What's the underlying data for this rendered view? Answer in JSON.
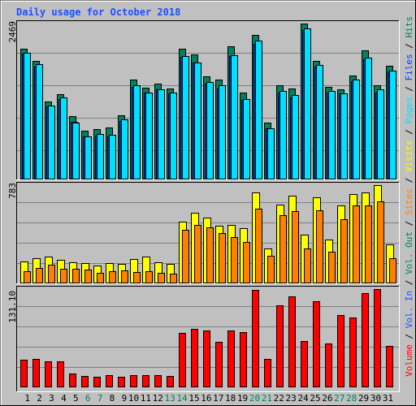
{
  "title": "Daily usage for October 2018",
  "colors": {
    "background": "#c0c0c0",
    "title": "#1a50ff",
    "gridline": "#808080",
    "weekday_label": "#000000",
    "weekend_label": "#00805c",
    "separator": "#000000"
  },
  "x_axis": {
    "weekend_days": [
      "6",
      "7",
      "13",
      "14",
      "20",
      "21",
      "27",
      "28"
    ]
  },
  "legend_separator": " / ",
  "legend": [
    {
      "label": "Volume",
      "color": "#ff0000"
    },
    {
      "label": "Vol. In",
      "color": "#1a50ff"
    },
    {
      "label": "Vol. Out",
      "color": "#00805c"
    },
    {
      "label": "Sites",
      "color": "#ff8000"
    },
    {
      "label": "Visits",
      "color": "#ffff00"
    },
    {
      "label": "Pages",
      "color": "#00e0ff"
    },
    {
      "label": "Files",
      "color": "#0040ff"
    },
    {
      "label": "Hits",
      "color": "#00805c"
    }
  ],
  "chart_data": [
    {
      "type": "bar",
      "panel": "hits-files-pages",
      "title": "Daily usage for October 2018",
      "xlabel": "",
      "ylabel": "",
      "ymax_label": "2469",
      "ylim": [
        0,
        2469
      ],
      "grid": true,
      "legend_placement": "right",
      "categories": [
        "1",
        "2",
        "3",
        "4",
        "5",
        "6",
        "7",
        "8",
        "9",
        "10",
        "11",
        "12",
        "13",
        "14",
        "15",
        "16",
        "17",
        "18",
        "19",
        "20",
        "21",
        "22",
        "23",
        "24",
        "25",
        "26",
        "27",
        "28",
        "29",
        "30",
        "31"
      ],
      "series": [
        {
          "name": "Hits",
          "color": "#00805c",
          "values": [
            2069,
            1875,
            1228,
            1345,
            996,
            763,
            789,
            815,
            1009,
            1577,
            1448,
            1513,
            1435,
            2069,
            1978,
            1629,
            1577,
            2108,
            1371,
            2289,
            892,
            1487,
            1435,
            2469,
            1875,
            1461,
            1422,
            1642,
            2043,
            1487,
            1797
          ]
        },
        {
          "name": "Files",
          "color": "#0040ff",
          "values": [
            1990,
            1788,
            1151,
            1267,
            905,
            672,
            685,
            672,
            918,
            1461,
            1371,
            1422,
            1358,
            1940,
            1849,
            1513,
            1435,
            1952,
            1254,
            2146,
            802,
            1371,
            1293,
            2366,
            1784,
            1371,
            1358,
            1552,
            1901,
            1371,
            1707
          ]
        },
        {
          "name": "Pages",
          "color": "#00e0ff",
          "values": [
            2004,
            1823,
            1164,
            1293,
            892,
            672,
            711,
            698,
            944,
            1487,
            1371,
            1422,
            1371,
            1952,
            1849,
            1539,
            1487,
            1965,
            1267,
            2198,
            802,
            1396,
            1332,
            2392,
            1810,
            1396,
            1358,
            1577,
            1927,
            1422,
            1720
          ]
        }
      ]
    },
    {
      "type": "bar",
      "panel": "visits-sites",
      "ymax_label": "783",
      "ylim": [
        0,
        783
      ],
      "grid": true,
      "categories": [
        "1",
        "2",
        "3",
        "4",
        "5",
        "6",
        "7",
        "8",
        "9",
        "10",
        "11",
        "12",
        "13",
        "14",
        "15",
        "16",
        "17",
        "18",
        "19",
        "20",
        "21",
        "22",
        "23",
        "24",
        "25",
        "26",
        "27",
        "28",
        "29",
        "30",
        "31"
      ],
      "series": [
        {
          "name": "Visits",
          "color": "#ffff00",
          "values": [
            170,
            196,
            209,
            183,
            163,
            157,
            137,
            157,
            150,
            189,
            209,
            163,
            150,
            489,
            561,
            522,
            457,
            463,
            437,
            724,
            274,
            626,
            698,
            385,
            685,
            346,
            620,
            711,
            724,
            783,
            307
          ]
        },
        {
          "name": "Sites",
          "color": "#ff8000",
          "values": [
            91,
            117,
            144,
            111,
            111,
            104,
            78,
            91,
            98,
            85,
            91,
            78,
            72,
            424,
            463,
            444,
            398,
            365,
            326,
            594,
            215,
            542,
            574,
            274,
            581,
            248,
            509,
            620,
            620,
            653,
            196
          ]
        }
      ]
    },
    {
      "type": "bar",
      "panel": "volume",
      "ymax_label": "131.10",
      "ylim": [
        0,
        131.1
      ],
      "grid": true,
      "categories": [
        "1",
        "2",
        "3",
        "4",
        "5",
        "6",
        "7",
        "8",
        "9",
        "10",
        "11",
        "12",
        "13",
        "14",
        "15",
        "16",
        "17",
        "18",
        "19",
        "20",
        "21",
        "22",
        "23",
        "24",
        "25",
        "26",
        "27",
        "28",
        "29",
        "30",
        "31"
      ],
      "series": [
        {
          "name": "Volume",
          "color": "#ff0000",
          "values": [
            36.05,
            37.15,
            33.87,
            33.87,
            17.48,
            14.2,
            13.11,
            15.3,
            13.11,
            15.3,
            15.3,
            15.3,
            14.2,
            72.11,
            77.57,
            75.38,
            60.09,
            75.38,
            73.2,
            130.01,
            37.15,
            109.25,
            121.27,
            61.18,
            114.71,
            57.9,
            96.14,
            92.86,
            125.64,
            131.1,
            54.63
          ]
        }
      ]
    }
  ]
}
